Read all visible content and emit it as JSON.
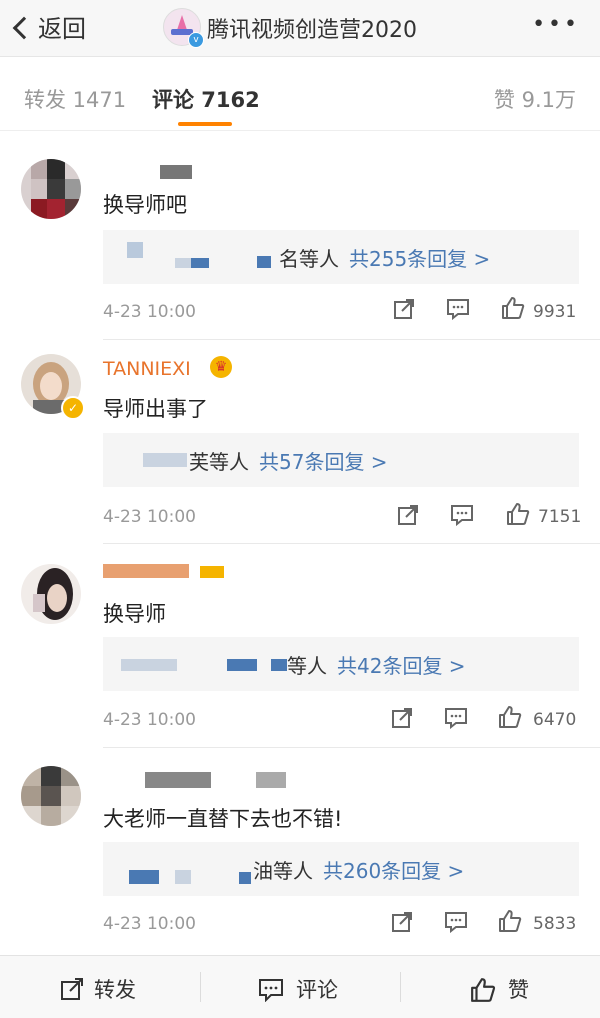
{
  "header": {
    "back_label": "返回",
    "title": "腾讯视频创造营2020",
    "more": "•••"
  },
  "tabs": {
    "repost": "转发 1471",
    "comments": "评论 7162",
    "likes": "赞 9.1万"
  },
  "comments": [
    {
      "name": "",
      "text": "换导师吧",
      "reply_by": "名等人",
      "reply_count": "共255条回复 >",
      "time": "4-23 10:00",
      "likes": "9931"
    },
    {
      "name": "TANNIEXI",
      "text": "导师出事了",
      "reply_by": "芙等人",
      "reply_count": "共57条回复 >",
      "time": "4-23 10:00",
      "likes": "7151"
    },
    {
      "name": "",
      "text": "换导师",
      "reply_by": "等人",
      "reply_count": "共42条回复 >",
      "time": "4-23 10:00",
      "likes": "6470"
    },
    {
      "name": "",
      "text": "大老师一直替下去也不错!",
      "reply_by": "油等人",
      "reply_count": "共260条回复 >",
      "time": "4-23 10:00",
      "likes": "5833"
    }
  ],
  "bottom": {
    "repost": "转发",
    "comment": "评论",
    "like": "赞"
  },
  "colors": {
    "accent": "#ff8200",
    "link": "#4a79b3",
    "vip_name": "#e8742c"
  }
}
